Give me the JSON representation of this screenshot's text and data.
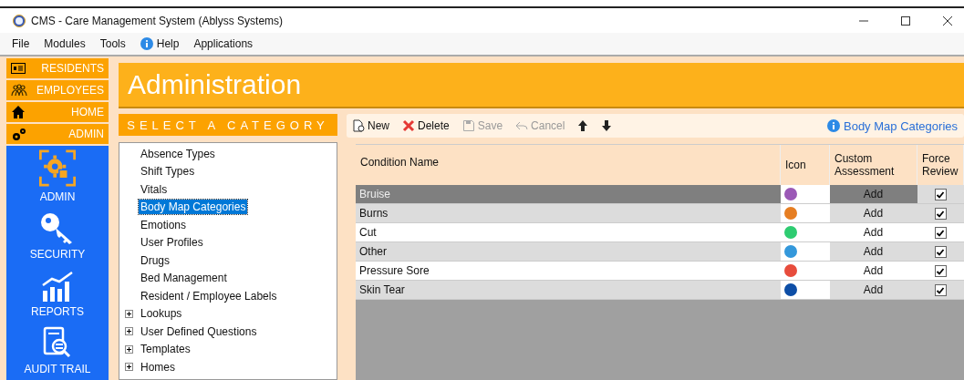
{
  "window": {
    "title": "CMS - Care Management System (Ablyss Systems)"
  },
  "menu": [
    {
      "label": "File",
      "kind": "plain"
    },
    {
      "label": "Modules",
      "kind": "plain"
    },
    {
      "label": "Tools",
      "kind": "plain"
    },
    {
      "label": "Help",
      "kind": "info"
    },
    {
      "label": "Applications",
      "kind": "plain"
    }
  ],
  "nav_buttons": [
    {
      "label": "RESIDENTS",
      "kind": "card"
    },
    {
      "label": "EMPLOYEES",
      "kind": "people"
    },
    {
      "label": "HOME",
      "kind": "house"
    },
    {
      "label": "ADMIN",
      "kind": "gears"
    }
  ],
  "modules": [
    {
      "label": "ADMIN",
      "kind": "admin"
    },
    {
      "label": "SECURITY",
      "kind": "key"
    },
    {
      "label": "REPORTS",
      "kind": "chart"
    },
    {
      "label": "AUDIT TRAIL",
      "kind": "audit"
    }
  ],
  "page_title": "Administration",
  "category_panel": {
    "title": "SELECT A CATEGORY",
    "items": [
      {
        "label": "Absence Types",
        "selected": false
      },
      {
        "label": "Shift Types",
        "selected": false
      },
      {
        "label": "Vitals",
        "selected": false
      },
      {
        "label": "Body Map Categories",
        "selected": true
      },
      {
        "label": "Emotions",
        "selected": false
      },
      {
        "label": "User Profiles",
        "selected": false
      },
      {
        "label": "Drugs",
        "selected": false
      },
      {
        "label": "Bed Management",
        "selected": false
      },
      {
        "label": "Resident / Employee Labels",
        "selected": false
      },
      {
        "label": "Lookups",
        "selected": false,
        "expanded": false
      },
      {
        "label": "User Defined Questions",
        "selected": false,
        "expanded": false
      },
      {
        "label": "Templates",
        "selected": false,
        "expanded": false
      },
      {
        "label": "Homes",
        "selected": false,
        "expanded": false
      }
    ]
  },
  "toolbar": {
    "buttons": [
      {
        "label": "New",
        "kind": "new",
        "disabled": false
      },
      {
        "label": "Delete",
        "kind": "delete",
        "disabled": false
      },
      {
        "label": "Save",
        "kind": "save",
        "disabled": true
      },
      {
        "label": "Cancel",
        "kind": "cancel",
        "disabled": true
      },
      {
        "kind": "up",
        "disabled": false
      },
      {
        "kind": "down",
        "disabled": false
      }
    ],
    "help_link": "Body Map Categories"
  },
  "table": {
    "columns": [
      "Condition Name",
      "Icon",
      "Custom Assessment",
      "Force Review"
    ],
    "rows": [
      {
        "name": "Bruise",
        "color": "#9b59b6",
        "custom_assessment": "Add",
        "force_review": true,
        "selected": true
      },
      {
        "name": "Burns",
        "color": "#e67e22",
        "custom_assessment": "Add",
        "force_review": true,
        "selected": false
      },
      {
        "name": "Cut",
        "color": "#2ecc71",
        "custom_assessment": "Add",
        "force_review": true,
        "selected": false
      },
      {
        "name": "Other",
        "color": "#3498db",
        "custom_assessment": "Add",
        "force_review": true,
        "selected": false
      },
      {
        "name": "Pressure Sore",
        "color": "#e74c3c",
        "custom_assessment": "Add",
        "force_review": true,
        "selected": false
      },
      {
        "name": "Skin Tear",
        "color": "#0d4ea6",
        "custom_assessment": "Add",
        "force_review": true,
        "selected": false
      }
    ]
  }
}
